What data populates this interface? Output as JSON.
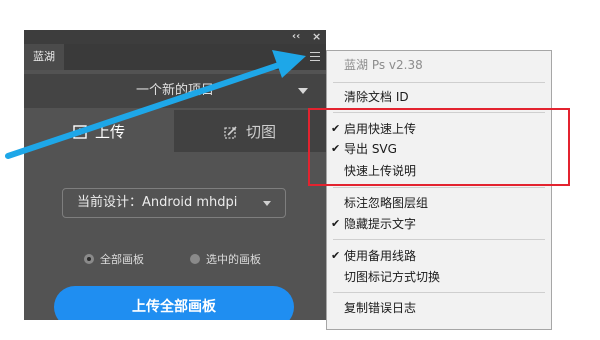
{
  "panel": {
    "tab_label": "蓝湖",
    "collapse_glyph": "‹‹",
    "close_glyph": "×",
    "project_name": "一个新的项目",
    "tabs": [
      {
        "label": "上传",
        "active": true
      },
      {
        "label": "切图",
        "active": false
      }
    ],
    "design_select": {
      "value": "当前设计：Android mhdpi"
    },
    "radios": [
      {
        "label": "全部画板",
        "selected": true
      },
      {
        "label": "选中的画板",
        "selected": false
      }
    ],
    "upload_button_label": "上传全部画板"
  },
  "menu": {
    "version": "蓝湖 Ps v2.38",
    "items": [
      {
        "label": "清除文档 ID",
        "checked": false
      },
      {
        "label": "启用快速上传",
        "checked": true
      },
      {
        "label": "导出 SVG",
        "checked": true
      },
      {
        "label": "快速上传说明",
        "checked": false
      },
      {
        "label": "标注忽略图层组",
        "checked": false
      },
      {
        "label": "隐藏提示文字",
        "checked": true
      },
      {
        "label": "使用备用线路",
        "checked": true
      },
      {
        "label": "切图标记方式切换",
        "checked": false
      },
      {
        "label": "复制错误日志",
        "checked": false
      }
    ],
    "check_glyph": "✔"
  },
  "colors": {
    "panel_bg": "#535353",
    "accent_blue": "#1f8ef1",
    "highlight_red": "#e3232f",
    "arrow_blue": "#1ea7e8"
  }
}
